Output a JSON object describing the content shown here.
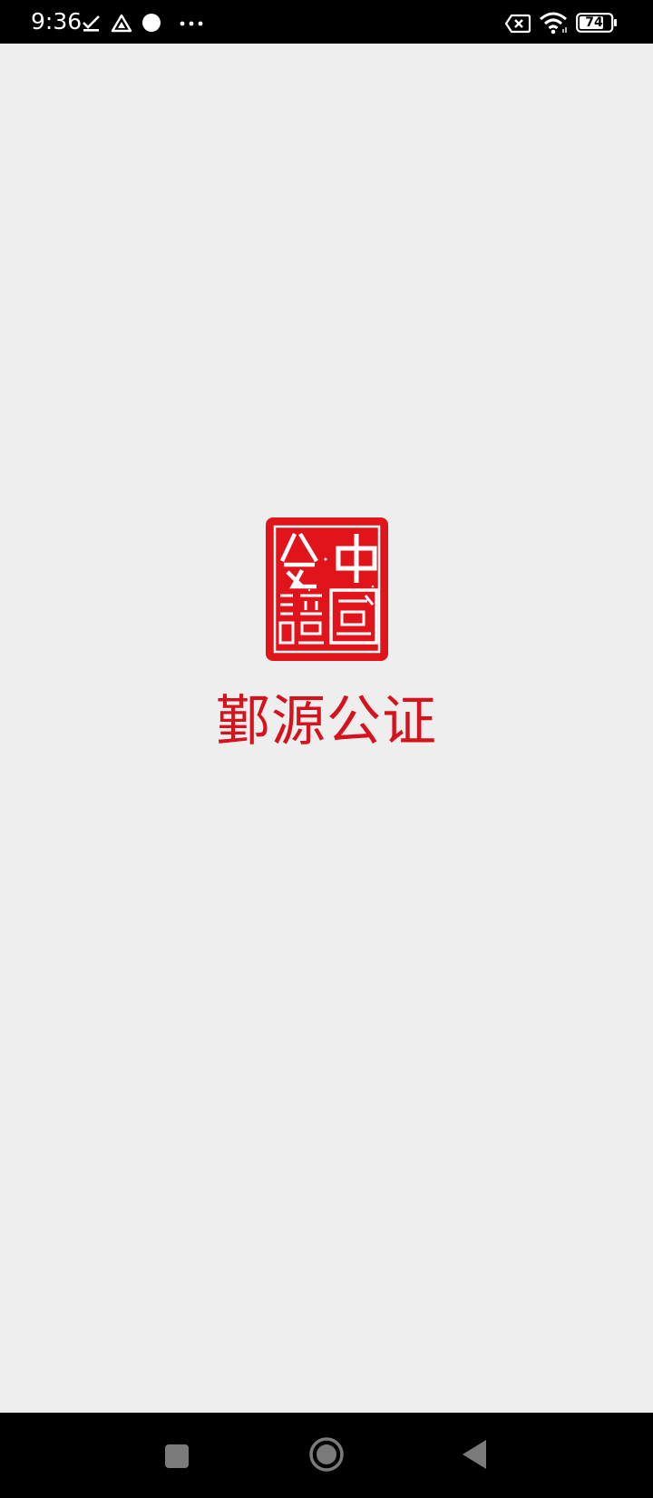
{
  "status_bar": {
    "time": "9:36",
    "battery_level": "74",
    "icons": [
      "check-download-icon",
      "drive-icon",
      "dot-icon",
      "more-notifications-icon",
      "data-off-icon",
      "wifi-icon",
      "battery-icon"
    ]
  },
  "splash": {
    "seal_text": "中國公證",
    "app_name": "鄞源公证",
    "brand_color": "#d6121c",
    "background_color": "#efeeee"
  },
  "nav_bar": {
    "buttons": [
      "recents-button",
      "home-button",
      "back-button"
    ]
  }
}
